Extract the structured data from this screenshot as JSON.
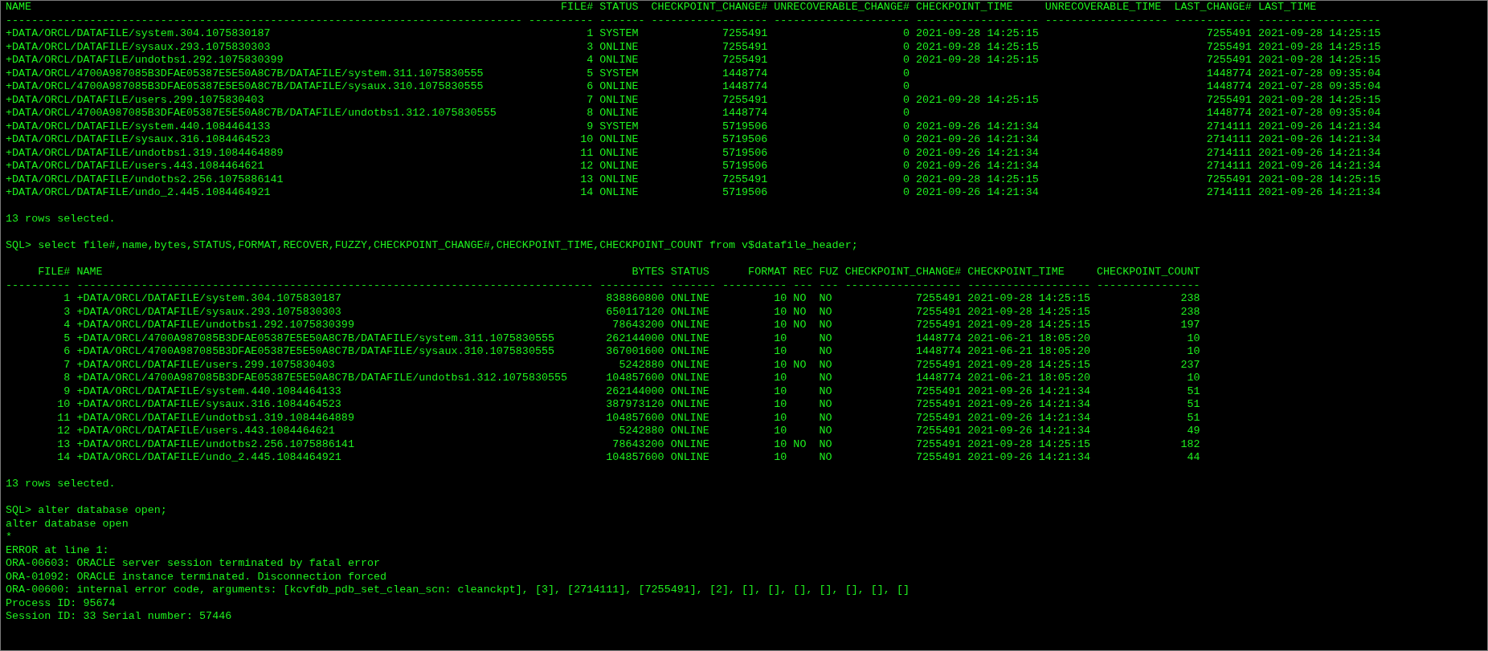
{
  "terminal": {
    "blocks": [
      {
        "kind": "table",
        "columns": [
          {
            "label": "NAME",
            "rule": "--------------------------------------------------------------------------------",
            "kind": "text"
          },
          {
            "label": "FILE#",
            "rule": "----------",
            "kind": "number"
          },
          {
            "label": "STATUS",
            "rule": "-------",
            "kind": "text"
          },
          {
            "label": "CHECKPOINT_CHANGE#",
            "rule": "------------------",
            "kind": "number"
          },
          {
            "label": "UNRECOVERABLE_CHANGE#",
            "rule": "---------------------",
            "kind": "number"
          },
          {
            "label": "CHECKPOINT_TIME",
            "rule": "-------------------",
            "kind": "text"
          },
          {
            "label": "UNRECOVERABLE_TIME",
            "rule": "-------------------",
            "kind": "text"
          },
          {
            "label": "LAST_CHANGE#",
            "rule": "------------",
            "kind": "number"
          },
          {
            "label": "LAST_TIME",
            "rule": "-------------------",
            "kind": "text"
          }
        ],
        "rows": [
          [
            "+DATA/ORCL/DATAFILE/system.304.1075830187",
            "1",
            "SYSTEM",
            "7255491",
            "0",
            "2021-09-28 14:25:15",
            null,
            "7255491",
            "2021-09-28 14:25:15"
          ],
          [
            "+DATA/ORCL/DATAFILE/sysaux.293.1075830303",
            "3",
            "ONLINE",
            "7255491",
            "0",
            "2021-09-28 14:25:15",
            null,
            "7255491",
            "2021-09-28 14:25:15"
          ],
          [
            "+DATA/ORCL/DATAFILE/undotbs1.292.1075830399",
            "4",
            "ONLINE",
            "7255491",
            "0",
            "2021-09-28 14:25:15",
            null,
            "7255491",
            "2021-09-28 14:25:15"
          ],
          [
            "+DATA/ORCL/4700A987085B3DFAE05387E5E50A8C7B/DATAFILE/system.311.1075830555",
            "5",
            "SYSTEM",
            "1448774",
            "0",
            null,
            null,
            "1448774",
            "2021-07-28 09:35:04"
          ],
          [
            "+DATA/ORCL/4700A987085B3DFAE05387E5E50A8C7B/DATAFILE/sysaux.310.1075830555",
            "6",
            "ONLINE",
            "1448774",
            "0",
            null,
            null,
            "1448774",
            "2021-07-28 09:35:04"
          ],
          [
            "+DATA/ORCL/DATAFILE/users.299.1075830403",
            "7",
            "ONLINE",
            "7255491",
            "0",
            "2021-09-28 14:25:15",
            null,
            "7255491",
            "2021-09-28 14:25:15"
          ],
          [
            "+DATA/ORCL/4700A987085B3DFAE05387E5E50A8C7B/DATAFILE/undotbs1.312.1075830555",
            "8",
            "ONLINE",
            "1448774",
            "0",
            null,
            null,
            "1448774",
            "2021-07-28 09:35:04"
          ],
          [
            "+DATA/ORCL/DATAFILE/system.440.1084464133",
            "9",
            "SYSTEM",
            "5719506",
            "0",
            "2021-09-26 14:21:34",
            null,
            "2714111",
            "2021-09-26 14:21:34"
          ],
          [
            "+DATA/ORCL/DATAFILE/sysaux.316.1084464523",
            "10",
            "ONLINE",
            "5719506",
            "0",
            "2021-09-26 14:21:34",
            null,
            "2714111",
            "2021-09-26 14:21:34"
          ],
          [
            "+DATA/ORCL/DATAFILE/undotbs1.319.1084464889",
            "11",
            "ONLINE",
            "5719506",
            "0",
            "2021-09-26 14:21:34",
            null,
            "2714111",
            "2021-09-26 14:21:34"
          ],
          [
            "+DATA/ORCL/DATAFILE/users.443.1084464621",
            "12",
            "ONLINE",
            "5719506",
            "0",
            "2021-09-26 14:21:34",
            null,
            "2714111",
            "2021-09-26 14:21:34"
          ],
          [
            "+DATA/ORCL/DATAFILE/undotbs2.256.1075886141",
            "13",
            "ONLINE",
            "7255491",
            "0",
            "2021-09-28 14:25:15",
            null,
            "7255491",
            "2021-09-28 14:25:15"
          ],
          [
            "+DATA/ORCL/DATAFILE/undo_2.445.1084464921",
            "14",
            "ONLINE",
            "5719506",
            "0",
            "2021-09-26 14:21:34",
            null,
            "2714111",
            "2021-09-26 14:21:34"
          ]
        ]
      },
      {
        "kind": "blank"
      },
      {
        "kind": "line",
        "text": "13 rows selected."
      },
      {
        "kind": "blank"
      },
      {
        "kind": "line",
        "text": "SQL> select file#,name,bytes,STATUS,FORMAT,RECOVER,FUZZY,CHECKPOINT_CHANGE#,CHECKPOINT_TIME,CHECKPOINT_COUNT from v$datafile_header;"
      },
      {
        "kind": "blank"
      },
      {
        "kind": "table",
        "columns": [
          {
            "label": "FILE#",
            "rule": "----------",
            "kind": "number"
          },
          {
            "label": "NAME",
            "rule": "--------------------------------------------------------------------------------",
            "kind": "text"
          },
          {
            "label": "BYTES",
            "rule": "----------",
            "kind": "number"
          },
          {
            "label": "STATUS",
            "rule": "-------",
            "kind": "text"
          },
          {
            "label": "FORMAT",
            "rule": "----------",
            "kind": "number"
          },
          {
            "label": "REC",
            "rule": "---",
            "kind": "text"
          },
          {
            "label": "FUZ",
            "rule": "---",
            "kind": "text"
          },
          {
            "label": "CHECKPOINT_CHANGE#",
            "rule": "------------------",
            "kind": "number"
          },
          {
            "label": "CHECKPOINT_TIME",
            "rule": "-------------------",
            "kind": "text"
          },
          {
            "label": "CHECKPOINT_COUNT",
            "rule": "----------------",
            "kind": "number"
          }
        ],
        "rows": [
          [
            "1",
            "+DATA/ORCL/DATAFILE/system.304.1075830187",
            "838860800",
            "ONLINE",
            "10",
            "NO",
            "NO",
            "7255491",
            "2021-09-28 14:25:15",
            "238"
          ],
          [
            "3",
            "+DATA/ORCL/DATAFILE/sysaux.293.1075830303",
            "650117120",
            "ONLINE",
            "10",
            "NO",
            "NO",
            "7255491",
            "2021-09-28 14:25:15",
            "238"
          ],
          [
            "4",
            "+DATA/ORCL/DATAFILE/undotbs1.292.1075830399",
            "78643200",
            "ONLINE",
            "10",
            "NO",
            "NO",
            "7255491",
            "2021-09-28 14:25:15",
            "197"
          ],
          [
            "5",
            "+DATA/ORCL/4700A987085B3DFAE05387E5E50A8C7B/DATAFILE/system.311.1075830555",
            "262144000",
            "ONLINE",
            "10",
            null,
            "NO",
            "1448774",
            "2021-06-21 18:05:20",
            "10"
          ],
          [
            "6",
            "+DATA/ORCL/4700A987085B3DFAE05387E5E50A8C7B/DATAFILE/sysaux.310.1075830555",
            "367001600",
            "ONLINE",
            "10",
            null,
            "NO",
            "1448774",
            "2021-06-21 18:05:20",
            "10"
          ],
          [
            "7",
            "+DATA/ORCL/DATAFILE/users.299.1075830403",
            "5242880",
            "ONLINE",
            "10",
            "NO",
            "NO",
            "7255491",
            "2021-09-28 14:25:15",
            "237"
          ],
          [
            "8",
            "+DATA/ORCL/4700A987085B3DFAE05387E5E50A8C7B/DATAFILE/undotbs1.312.1075830555",
            "104857600",
            "ONLINE",
            "10",
            null,
            "NO",
            "1448774",
            "2021-06-21 18:05:20",
            "10"
          ],
          [
            "9",
            "+DATA/ORCL/DATAFILE/system.440.1084464133",
            "262144000",
            "ONLINE",
            "10",
            null,
            "NO",
            "7255491",
            "2021-09-26 14:21:34",
            "51"
          ],
          [
            "10",
            "+DATA/ORCL/DATAFILE/sysaux.316.1084464523",
            "387973120",
            "ONLINE",
            "10",
            null,
            "NO",
            "7255491",
            "2021-09-26 14:21:34",
            "51"
          ],
          [
            "11",
            "+DATA/ORCL/DATAFILE/undotbs1.319.1084464889",
            "104857600",
            "ONLINE",
            "10",
            null,
            "NO",
            "7255491",
            "2021-09-26 14:21:34",
            "51"
          ],
          [
            "12",
            "+DATA/ORCL/DATAFILE/users.443.1084464621",
            "5242880",
            "ONLINE",
            "10",
            null,
            "NO",
            "7255491",
            "2021-09-26 14:21:34",
            "49"
          ],
          [
            "13",
            "+DATA/ORCL/DATAFILE/undotbs2.256.1075886141",
            "78643200",
            "ONLINE",
            "10",
            "NO",
            "NO",
            "7255491",
            "2021-09-28 14:25:15",
            "182"
          ],
          [
            "14",
            "+DATA/ORCL/DATAFILE/undo_2.445.1084464921",
            "104857600",
            "ONLINE",
            "10",
            null,
            "NO",
            "7255491",
            "2021-09-26 14:21:34",
            "44"
          ]
        ]
      },
      {
        "kind": "blank"
      },
      {
        "kind": "line",
        "text": "13 rows selected."
      },
      {
        "kind": "blank"
      },
      {
        "kind": "line",
        "text": "SQL> alter database open;"
      },
      {
        "kind": "line",
        "text": "alter database open"
      },
      {
        "kind": "line",
        "text": "*"
      },
      {
        "kind": "line",
        "text": "ERROR at line 1:"
      },
      {
        "kind": "line",
        "text": "ORA-00603: ORACLE server session terminated by fatal error"
      },
      {
        "kind": "line",
        "text": "ORA-01092: ORACLE instance terminated. Disconnection forced"
      },
      {
        "kind": "line",
        "text": "ORA-00600: internal error code, arguments: [kcvfdb_pdb_set_clean_scn: cleanckpt], [3], [2714111], [7255491], [2], [], [], [], [], [], [], []"
      },
      {
        "kind": "line",
        "text": "Process ID: 95674"
      },
      {
        "kind": "line",
        "text": "Session ID: 33 Serial number: 57446"
      }
    ]
  }
}
